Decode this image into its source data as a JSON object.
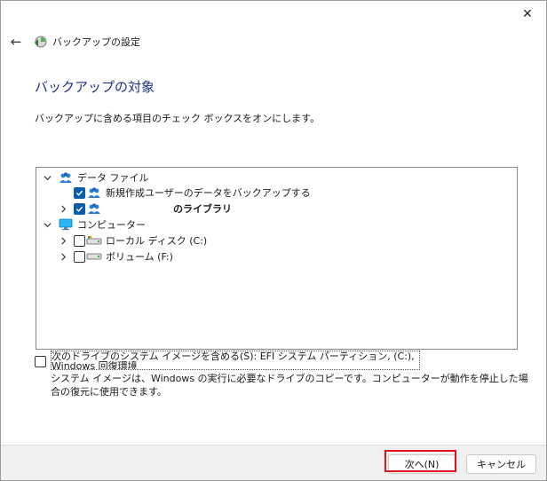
{
  "window": {
    "title": "バックアップの設定",
    "close_glyph": "✕",
    "back_glyph": "←"
  },
  "section": {
    "title": "バックアップの対象",
    "description": "バックアップに含める項目のチェック ボックスをオンにします。"
  },
  "tree": {
    "items": [
      {
        "label": "データ ファイル",
        "expanded": true,
        "checkbox": false,
        "icon": "users-icon"
      },
      {
        "label": "新規作成ユーザーのデータをバックアップする",
        "checked": true,
        "icon": "users-icon"
      },
      {
        "label": "のライブラリ",
        "checked": true,
        "icon": "users-icon",
        "bold": true,
        "collapsed": true
      },
      {
        "label": "コンピューター",
        "expanded": true,
        "checkbox": false,
        "icon": "monitor-icon"
      },
      {
        "label": "ローカル ディスク (C:)",
        "checked": false,
        "icon": "disk-icon",
        "collapsed": true
      },
      {
        "label": "ボリューム (F:)",
        "checked": false,
        "icon": "drive-icon",
        "collapsed": true
      }
    ]
  },
  "system_image": {
    "checkbox_label": "次のドライブのシステム イメージを含める(S): EFI システム パーティション, (C:), Windows 回復環境",
    "description": "システム イメージは、Windows の実行に必要なドライブのコピーです。コンピューターが動作を停止した場合の復元に使用できます。",
    "checked": false
  },
  "buttons": {
    "next": "次へ(N)",
    "cancel": "キャンセル"
  },
  "colors": {
    "title_blue": "#1e3287",
    "checkbox_blue": "#0b5cad",
    "highlight_red": "#e3141b"
  }
}
